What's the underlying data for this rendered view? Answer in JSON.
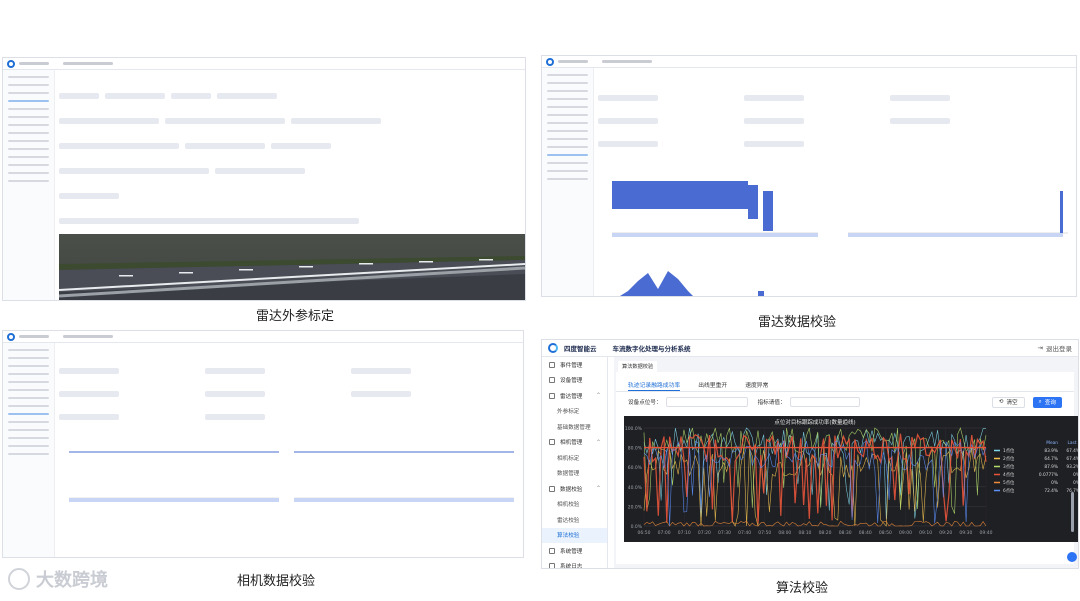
{
  "captions": {
    "radar_calib": "雷达外参标定",
    "radar_check": "雷达数据校验",
    "camera_check": "相机数据校验",
    "algo_check": "算法校验"
  },
  "watermark": "大数跨境",
  "app": {
    "brand": "四度智能云",
    "system_title": "车流数字化处理与分析系统",
    "exit_label": "退出登录",
    "breadcrumb": "算法数据校验"
  },
  "sidebar": {
    "items": [
      {
        "label": "事件管理",
        "type": "group"
      },
      {
        "label": "设备管理",
        "type": "group"
      },
      {
        "label": "雷达管理",
        "type": "group",
        "expanded": true
      },
      {
        "label": "外参标定",
        "type": "sub"
      },
      {
        "label": "基础数据管理",
        "type": "sub"
      },
      {
        "label": "相机管理",
        "type": "group",
        "expanded": true
      },
      {
        "label": "相机标定",
        "type": "sub"
      },
      {
        "label": "数据管理",
        "type": "sub"
      },
      {
        "label": "数据校验",
        "type": "group",
        "expanded": true
      },
      {
        "label": "相机校验",
        "type": "sub"
      },
      {
        "label": "雷达校验",
        "type": "sub"
      },
      {
        "label": "算法校验",
        "type": "sub",
        "active": true
      },
      {
        "label": "系统管理",
        "type": "group"
      },
      {
        "label": "系统日志",
        "type": "group"
      }
    ]
  },
  "tabs": [
    {
      "label": "轨迹记录融路成功率",
      "active": true
    },
    {
      "label": "出线里重开",
      "active": false
    },
    {
      "label": "速度异常",
      "active": false
    }
  ],
  "filters": {
    "device_label": "设备点位号：",
    "metric_label": "指标请值："
  },
  "buttons": {
    "reset": "清空",
    "query": "查询"
  },
  "chart_data": {
    "type": "line",
    "title": "点位对目标跟踪成功率(数量趋线)",
    "y_ticks": [
      "100.0%",
      "80.0%",
      "60.0%",
      "40.0%",
      "20.0%",
      "0.0%"
    ],
    "x": [
      "06:50",
      "07:00",
      "07:10",
      "07:20",
      "07:30",
      "07:40",
      "07:50",
      "08:00",
      "08:10",
      "08:20",
      "08:30",
      "08:40",
      "08:50",
      "09:00",
      "09:10",
      "09:20",
      "09:30",
      "09:40"
    ],
    "ylim": [
      0,
      100
    ],
    "legend_header": {
      "mean": "Mean",
      "last": "Last *"
    },
    "series": [
      {
        "name": "1点位",
        "color": "#7fd6e8",
        "mean": "83.9%",
        "last": "67.4%",
        "level": 86
      },
      {
        "name": "2点位",
        "color": "#f2c14e",
        "mean": "64.7%",
        "last": "67.4%",
        "level": 64
      },
      {
        "name": "3点位",
        "color": "#b4dc6a",
        "mean": "87.9%",
        "last": "93.2%",
        "level": 88
      },
      {
        "name": "4点位",
        "color": "#e8543a",
        "mean": "0.0777%",
        "last": "0%",
        "level": 80
      },
      {
        "name": "5点位",
        "color": "#f08c3a",
        "mean": "0%",
        "last": "0%",
        "level": 2
      },
      {
        "name": "6点位",
        "color": "#5b8ff9",
        "mean": "72.4%",
        "last": "76.7%",
        "level": 72
      }
    ]
  }
}
